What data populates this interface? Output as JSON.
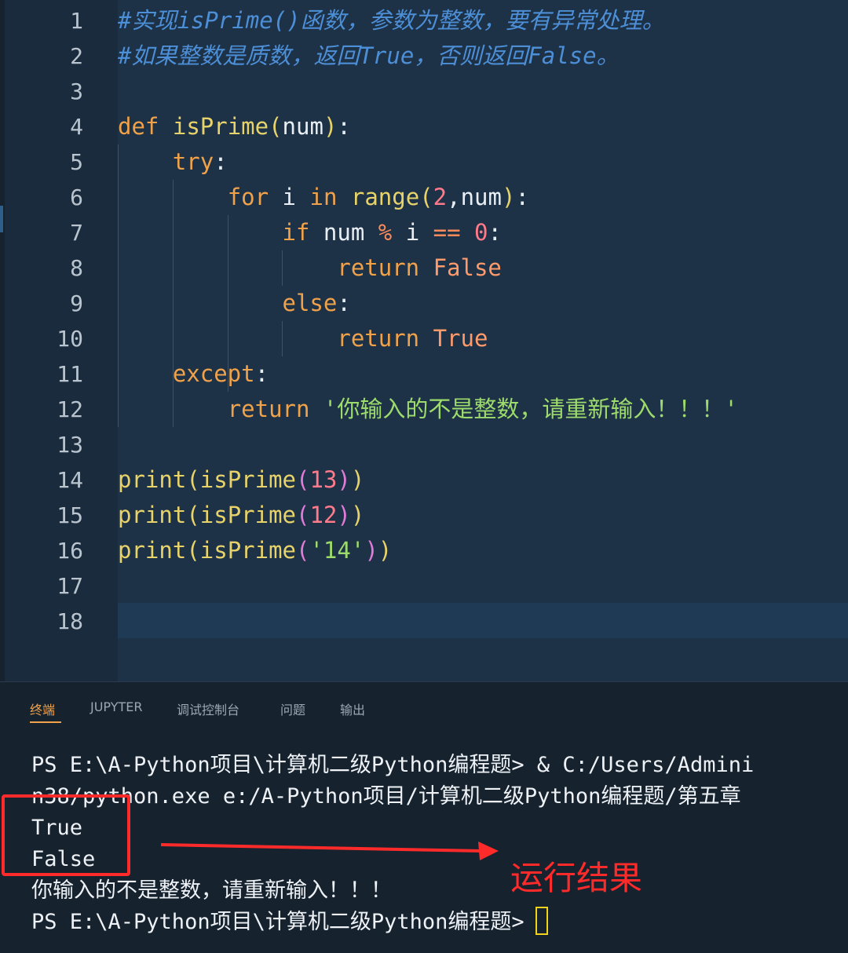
{
  "editor": {
    "lines": [
      {
        "n": "1",
        "html": "<span class=\"t-comment\">#实现isPrime()函数，参数为整数，要有异常处理。</span>"
      },
      {
        "n": "2",
        "html": "<span class=\"t-comment\">#如果整数是质数，返回True，否则返回False。</span>"
      },
      {
        "n": "3",
        "html": ""
      },
      {
        "n": "4",
        "html": "<span class=\"t-kw\">def</span> <span class=\"t-fn\">isPrime</span><span class=\"t-p1\">(</span><span class=\"t-var\">num</span><span class=\"t-p1\">)</span>:"
      },
      {
        "n": "5",
        "html": "    <span class=\"t-kw\">try</span>:"
      },
      {
        "n": "6",
        "html": "        <span class=\"t-kw\">for</span> <span class=\"t-var\">i</span> <span class=\"t-kw\">in</span> <span class=\"t-fn\">range</span><span class=\"t-p1\">(</span><span class=\"t-num\">2</span>,<span class=\"t-var\">num</span><span class=\"t-p1\">)</span>:"
      },
      {
        "n": "7",
        "html": "            <span class=\"t-kw\">if</span> <span class=\"t-var\">num</span> <span class=\"t-op\">%</span> <span class=\"t-var\">i</span> <span class=\"t-op\">==</span> <span class=\"t-num\">0</span>:"
      },
      {
        "n": "8",
        "html": "                <span class=\"t-kw\">return</span> <span class=\"t-bool\">False</span>"
      },
      {
        "n": "9",
        "html": "            <span class=\"t-kw\">else</span>:"
      },
      {
        "n": "10",
        "html": "                <span class=\"t-kw\">return</span> <span class=\"t-bool\">True</span>"
      },
      {
        "n": "11",
        "html": "    <span class=\"t-kw\">except</span>:"
      },
      {
        "n": "12",
        "html": "        <span class=\"t-kw\">return</span> <span class=\"t-str\">'你输入的不是整数，请重新输入！！！'</span>"
      },
      {
        "n": "13",
        "html": ""
      },
      {
        "n": "14",
        "html": "<span class=\"t-fn\">print</span><span class=\"t-p1\">(</span><span class=\"t-fn\">isPrime</span><span class=\"t-p2\">(</span><span class=\"t-num\">13</span><span class=\"t-p2\">)</span><span class=\"t-p1\">)</span>"
      },
      {
        "n": "15",
        "html": "<span class=\"t-fn\">print</span><span class=\"t-p1\">(</span><span class=\"t-fn\">isPrime</span><span class=\"t-p2\">(</span><span class=\"t-num\">12</span><span class=\"t-p2\">)</span><span class=\"t-p1\">)</span>"
      },
      {
        "n": "16",
        "html": "<span class=\"t-fn\">print</span><span class=\"t-p1\">(</span><span class=\"t-fn\">isPrime</span><span class=\"t-p2\">(</span><span class=\"t-str\">'14'</span><span class=\"t-p2\">)</span><span class=\"t-p1\">)</span>"
      },
      {
        "n": "17",
        "html": ""
      },
      {
        "n": "18",
        "html": ""
      }
    ]
  },
  "panel": {
    "tabs": [
      "终端",
      "JUPYTER",
      "调试控制台",
      "问题",
      "输出"
    ],
    "active_tab": "终端",
    "terminal_lines": [
      "PS E:\\A-Python项目\\计算机二级Python编程题> & C:/Users/Admini",
      "n38/python.exe e:/A-Python项目/计算机二级Python编程题/第五章",
      "True",
      "False",
      "你输入的不是整数，请重新输入！！！",
      "PS E:\\A-Python项目\\计算机二级Python编程题>"
    ]
  },
  "annotation": {
    "label": "运行结果",
    "color": "#ff2a2a"
  },
  "colors": {
    "keyword": "#f0a24a",
    "function": "#e8d36a",
    "comment": "#4d8fd6",
    "string": "#9ddb6c",
    "number": "#ff7a8a"
  }
}
